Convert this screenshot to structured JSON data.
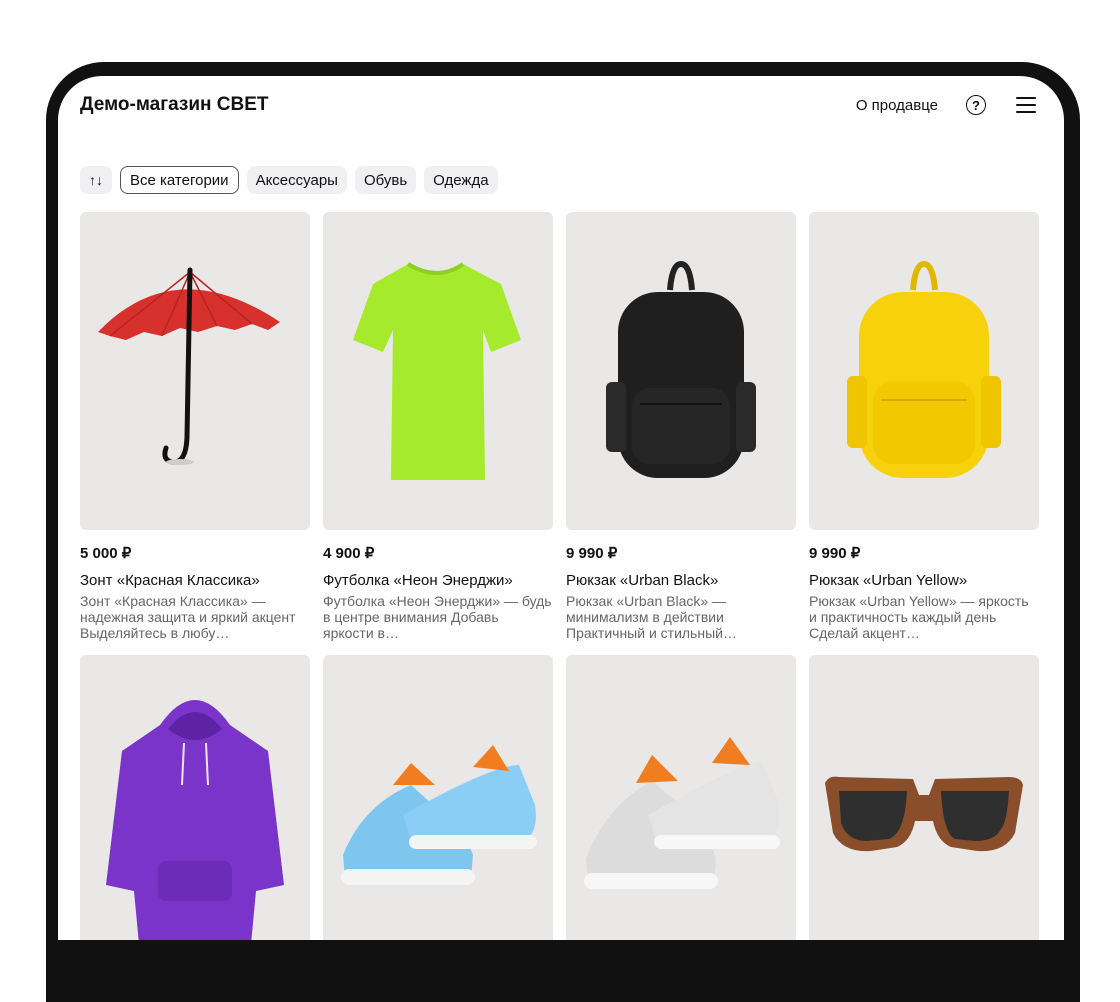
{
  "header": {
    "store_title": "Демо-магазин СВЕТ",
    "about_seller": "О продавце",
    "help_icon": "question-circle-icon",
    "menu_icon": "hamburger-menu-icon"
  },
  "filters": {
    "sort_icon": "sort-arrows-icon",
    "sort_glyph": "↑↓",
    "categories": [
      "Все категории",
      "Аксессуары",
      "Обувь",
      "Одежда"
    ],
    "active": "Все категории"
  },
  "products": [
    {
      "price": "5 000 ₽",
      "name": "Зонт «Красная Классика»",
      "description": "Зонт «Красная Классика» — надежная защита и яркий акцент Выделяйтесь в любу…",
      "image": "red-umbrella"
    },
    {
      "price": "4 900 ₽",
      "name": "Футболка «Неон Энерджи»",
      "description": "Футболка «Неон Энерджи» — будь в центре внимания Добавь яркости в…",
      "image": "neon-green-tshirt"
    },
    {
      "price": "9 990 ₽",
      "name": "Рюкзак «Urban Black»",
      "description": "Рюкзак «Urban Black» — минимализм в действии Практичный и стильный…",
      "image": "black-backpack"
    },
    {
      "price": "9 990 ₽",
      "name": "Рюкзак «Urban Yellow»",
      "description": "Рюкзак «Urban Yellow» — яркость и практичность каждый день Сделай акцент…",
      "image": "yellow-backpack"
    },
    {
      "image": "purple-hoodie"
    },
    {
      "image": "blue-sneakers"
    },
    {
      "image": "grey-sneakers"
    },
    {
      "image": "wooden-sunglasses"
    }
  ],
  "colors": {
    "card_bg": "#e9e8e6",
    "chip_bg": "#f0f0f2",
    "text": "#111111",
    "muted": "#666666"
  }
}
